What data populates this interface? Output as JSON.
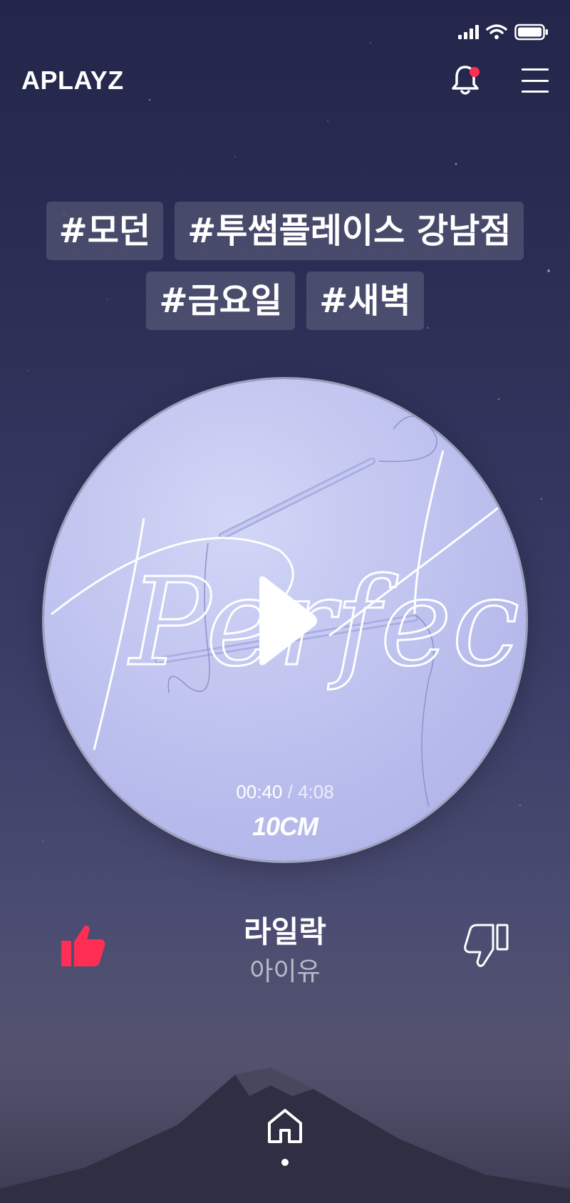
{
  "status_bar": {
    "signal_icon": "cellular-signal-icon",
    "wifi_icon": "wifi-icon",
    "battery_icon": "battery-icon"
  },
  "header": {
    "logo": "APLAYZ",
    "notification_icon": "bell-icon",
    "menu_icon": "hamburger-menu-icon",
    "notification_dot_color": "#ff2e55"
  },
  "tags": [
    "#모던",
    "#투썸플레이스 강남점",
    "#금요일",
    "#새벽"
  ],
  "player": {
    "current_time": "00:40",
    "separator": " / ",
    "total_time": "4:08",
    "album_label": "10CM",
    "album_art_text": "Perfect",
    "play_icon": "play-icon"
  },
  "track": {
    "title": "라일락",
    "artist": "아이유",
    "like_icon": "thumbs-up-icon",
    "dislike_icon": "thumbs-down-icon",
    "like_color": "#ff2e55"
  },
  "bottom_nav": {
    "home_icon": "home-icon"
  }
}
